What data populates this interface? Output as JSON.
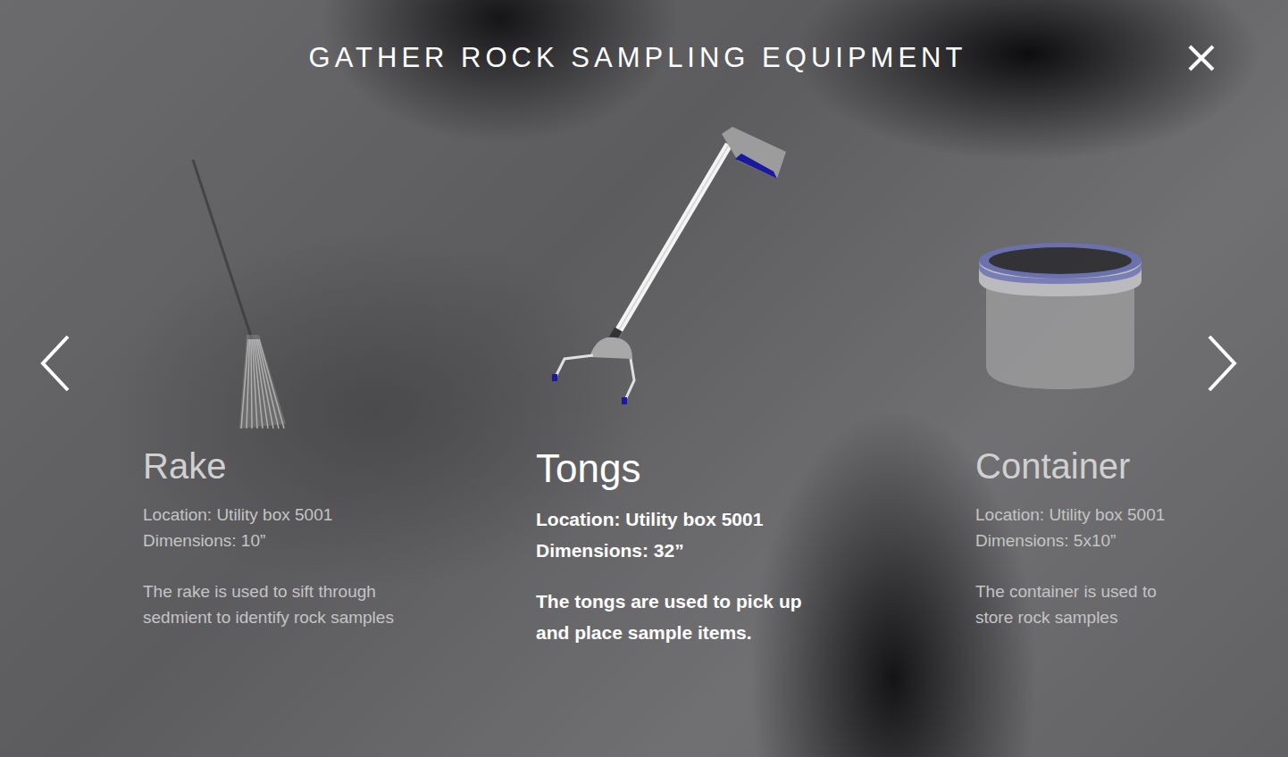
{
  "title": "GATHER ROCK SAMPLING EQUIPMENT",
  "items": [
    {
      "kind": "rake",
      "name": "Rake",
      "location": "Location: Utility box 5001",
      "dimensions": "Dimensions: 10”",
      "description": "The rake is used to sift through sedmient to identify rock samples",
      "selected": false
    },
    {
      "kind": "tongs",
      "name": "Tongs",
      "location": "Location: Utility box 5001",
      "dimensions": "Dimensions: 32”",
      "description": "The tongs are used to pick up and place sample items.",
      "selected": true
    },
    {
      "kind": "container",
      "name": "Container",
      "location": "Location: Utility box 5001",
      "dimensions": "Dimensions: 5x10”",
      "description": "The container is used to store rock samples",
      "selected": false
    }
  ]
}
